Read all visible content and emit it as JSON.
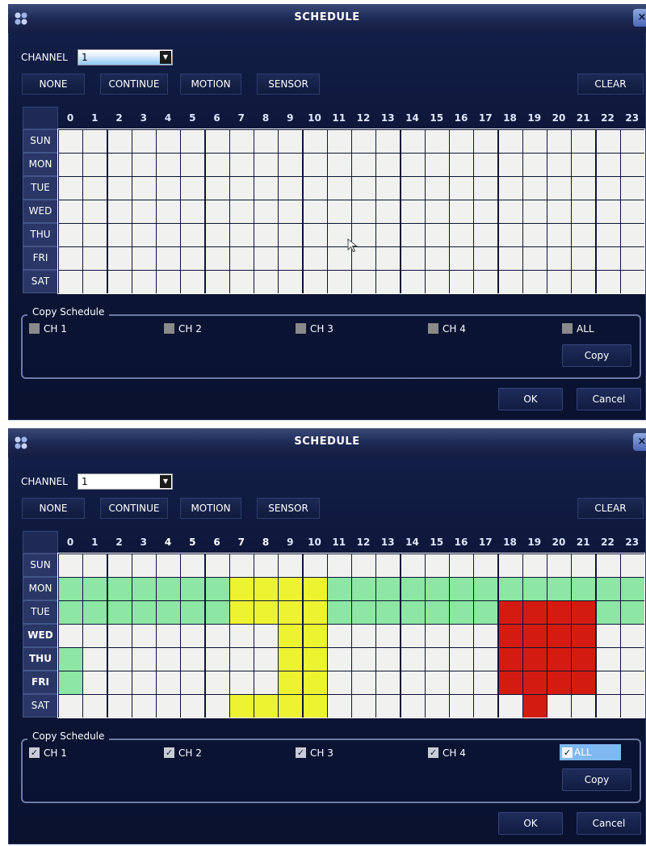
{
  "window": {
    "title": "SCHEDULE",
    "close_label": "×"
  },
  "channel": {
    "label": "CHANNEL",
    "value": "1"
  },
  "modes": {
    "none": "NONE",
    "continue": "CONTINUE",
    "motion": "MOTION",
    "sensor": "SENSOR",
    "clear": "CLEAR"
  },
  "hours": [
    "0",
    "1",
    "2",
    "3",
    "4",
    "5",
    "6",
    "7",
    "8",
    "9",
    "10",
    "11",
    "12",
    "13",
    "14",
    "15",
    "16",
    "17",
    "18",
    "19",
    "20",
    "21",
    "22",
    "23"
  ],
  "days": [
    "SUN",
    "MON",
    "TUE",
    "WED",
    "THU",
    "FRI",
    "SAT"
  ],
  "copy_schedule": {
    "title": "Copy Schedule",
    "channels": [
      "CH 1",
      "CH 2",
      "CH 3",
      "CH 4"
    ],
    "all_label": "ALL",
    "copy_label": "Copy"
  },
  "footer": {
    "ok": "OK",
    "cancel": "Cancel"
  },
  "colors": {
    "empty": "#f1f2ef",
    "continue": "#8ee6a4",
    "motion": "#ecf331",
    "sensor": "#d41b12"
  },
  "icons": {
    "app": "app-logo-icon",
    "close": "close-icon",
    "dropdown": "chevron-down-icon",
    "cursor": "mouse-pointer-icon"
  },
  "panels": [
    {
      "id": "before",
      "channel_select_highlighted": true,
      "checks": {
        "ch": [
          false,
          false,
          false,
          false
        ],
        "all": false
      },
      "bold_days": [],
      "bold_hours": [],
      "show_cursor": true,
      "grid": [
        "........................",
        "........................",
        "........................",
        "........................",
        "........................",
        "........................",
        "........................"
      ]
    },
    {
      "id": "after",
      "channel_select_highlighted": false,
      "checks": {
        "ch": [
          true,
          true,
          true,
          true
        ],
        "all": true
      },
      "bold_days": [
        "WED",
        "THU",
        "FRI"
      ],
      "bold_hours": [
        "4",
        "5",
        "6",
        "7",
        "8"
      ],
      "show_cursor": false,
      "grid": [
        "........................",
        "CCCCCCCMMMMCCCCCCCCCCCCC",
        "CCCCCCCMMMMCCCCCCCSSSSCC",
        ".........MM.......SSSS..",
        "C........MM.......SSSS..",
        "C........MM.......SSSS..",
        ".......MMMM........S...."
      ]
    }
  ]
}
